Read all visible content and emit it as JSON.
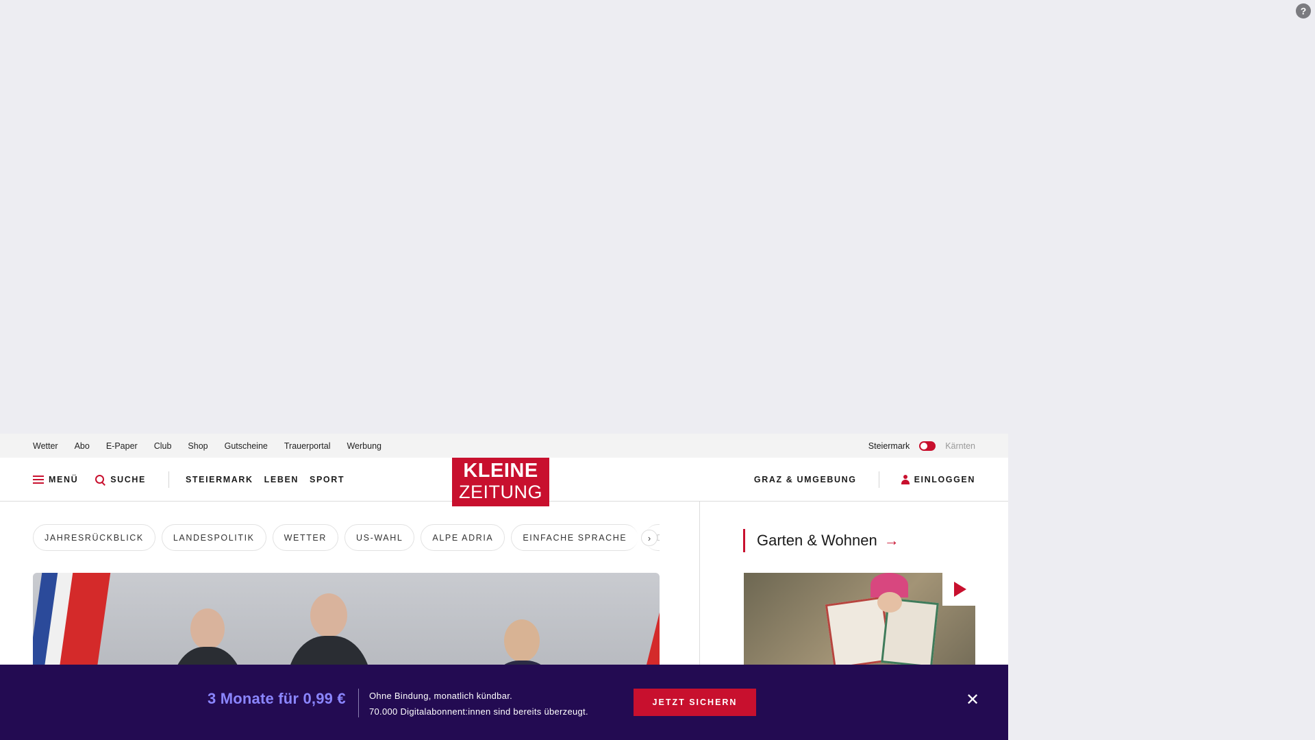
{
  "topbar": {
    "links": [
      "Wetter",
      "Abo",
      "E-Paper",
      "Club",
      "Shop",
      "Gutscheine",
      "Trauerportal",
      "Werbung"
    ],
    "region_active": "Steiermark",
    "region_inactive": "Kärnten"
  },
  "header": {
    "menu_label": "MENÜ",
    "search_label": "SUCHE",
    "nav": [
      "STEIERMARK",
      "LEBEN",
      "SPORT"
    ],
    "logo_line1": "KLEINE",
    "logo_line2": "ZEITUNG",
    "region_link": "GRAZ & UMGEBUNG",
    "login_label": "EINLOGGEN"
  },
  "tags": [
    "JAHRESRÜCKBLICK",
    "LANDESPOLITIK",
    "WETTER",
    "US-WAHL",
    "ALPE ADRIA",
    "EINFACHE SPRACHE",
    "DOS"
  ],
  "sidebar": {
    "section_title": "Garten & Wohnen"
  },
  "promo": {
    "price": "3 Monate für 0,99 €",
    "line1": "Ohne Bindung, monatlich kündbar.",
    "line2": "70.000 Digitalabonnent:innen sind bereits überzeugt.",
    "cta": "JETZT SICHERN"
  },
  "colors": {
    "brand_red": "#c8102e",
    "promo_bg": "#230b52",
    "promo_price": "#8b86ff",
    "page_bg": "#ededf2"
  }
}
